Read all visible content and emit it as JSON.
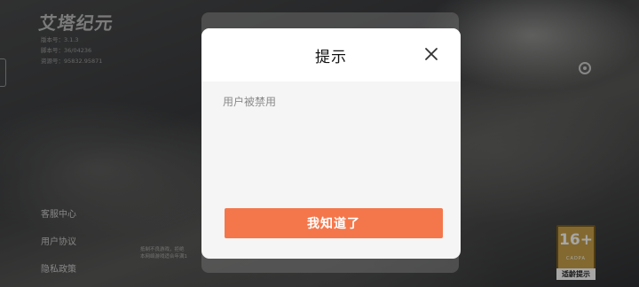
{
  "game": {
    "logo_text": "艾塔纪元",
    "version_lines": [
      "版本号：3.1.3",
      "脚本号：36/04236",
      "资源号：95832.95871"
    ]
  },
  "side_links": [
    "客服中心",
    "用户协议",
    "隐私政策"
  ],
  "notice_lines": [
    "抵制不良游戏，拒绝",
    "本网络游戏适合年满1"
  ],
  "age_rating": {
    "number": "16+",
    "org": "CADPA",
    "label": "适龄提示"
  },
  "dialog": {
    "title": "提示",
    "message": "用户被禁用",
    "confirm_label": "我知道了",
    "close_icon": "close-icon"
  },
  "colors": {
    "confirm_button": "#f4774b",
    "badge": "#c9a24a"
  }
}
